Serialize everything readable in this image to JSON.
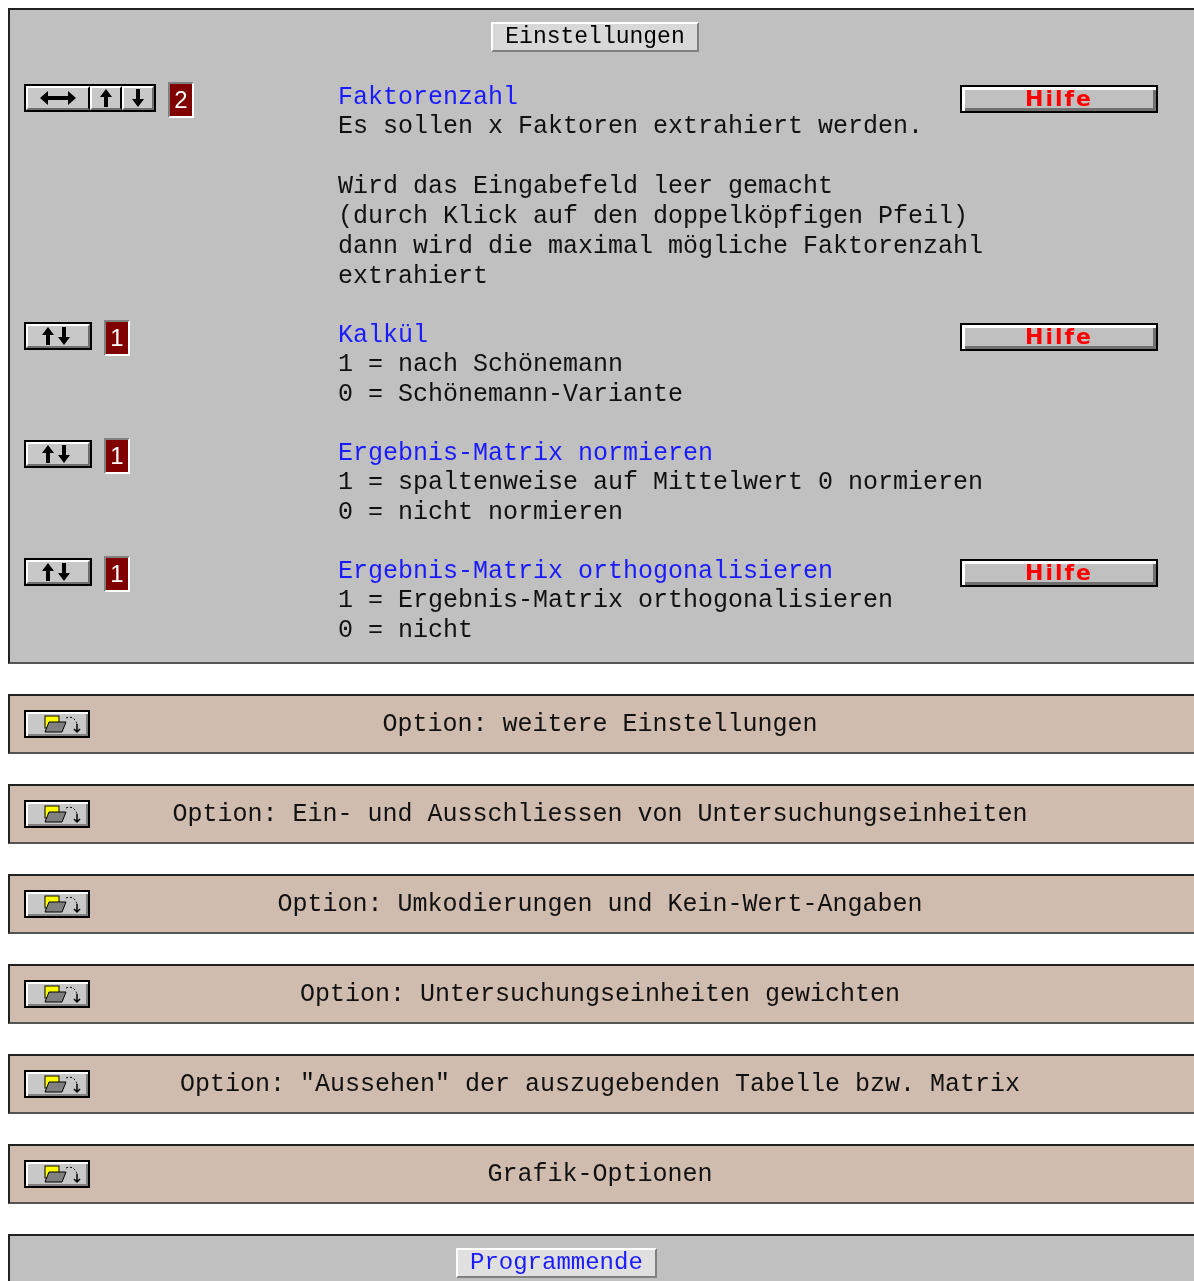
{
  "settings_panel": {
    "title": "Einstellungen",
    "items": [
      {
        "controls": [
          {
            "kind": "leftright"
          },
          {
            "kind": "up"
          },
          {
            "kind": "down"
          }
        ],
        "value": "2",
        "title": "Faktorenzahl",
        "help": "Hilfe",
        "paragraphs": [
          [
            "Es sollen x Faktoren extrahiert werden."
          ],
          [
            "Wird das Eingabefeld leer gemacht",
            "(durch Klick auf den doppelköpfigen Pfeil)",
            "dann wird die maximal mögliche Faktorenzahl",
            "extrahiert"
          ]
        ]
      },
      {
        "controls": [
          {
            "kind": "updown"
          }
        ],
        "value": "1",
        "title": "Kalkül",
        "help": "Hilfe",
        "paragraphs": [
          [
            "1 = nach Schönemann",
            "0 = Schönemann-Variante"
          ]
        ]
      },
      {
        "controls": [
          {
            "kind": "updown"
          }
        ],
        "value": "1",
        "title": "Ergebnis-Matrix normieren",
        "paragraphs": [
          [
            "1 = spaltenweise auf Mittelwert 0 normieren",
            "0 = nicht normieren"
          ]
        ]
      },
      {
        "controls": [
          {
            "kind": "updown"
          }
        ],
        "value": "1",
        "title": "Ergebnis-Matrix orthogonalisieren",
        "help": "Hilfe",
        "paragraphs": [
          [
            "1 = Ergebnis-Matrix orthogonalisieren",
            "0 = nicht"
          ]
        ]
      }
    ]
  },
  "option_bars": [
    {
      "label": "Option: weitere Einstellungen"
    },
    {
      "label": "Option: Ein- und Ausschliessen von Untersuchungseinheiten"
    },
    {
      "label": "Option: Umkodierungen und Kein-Wert-Angaben"
    },
    {
      "label": "Option: Untersuchungseinheiten gewichten"
    },
    {
      "label": "Option: \"Aussehen\" der auszugebenden Tabelle bzw. Matrix"
    },
    {
      "label": "Grafik-Optionen"
    }
  ],
  "end_panel": {
    "button": "Programmende"
  }
}
